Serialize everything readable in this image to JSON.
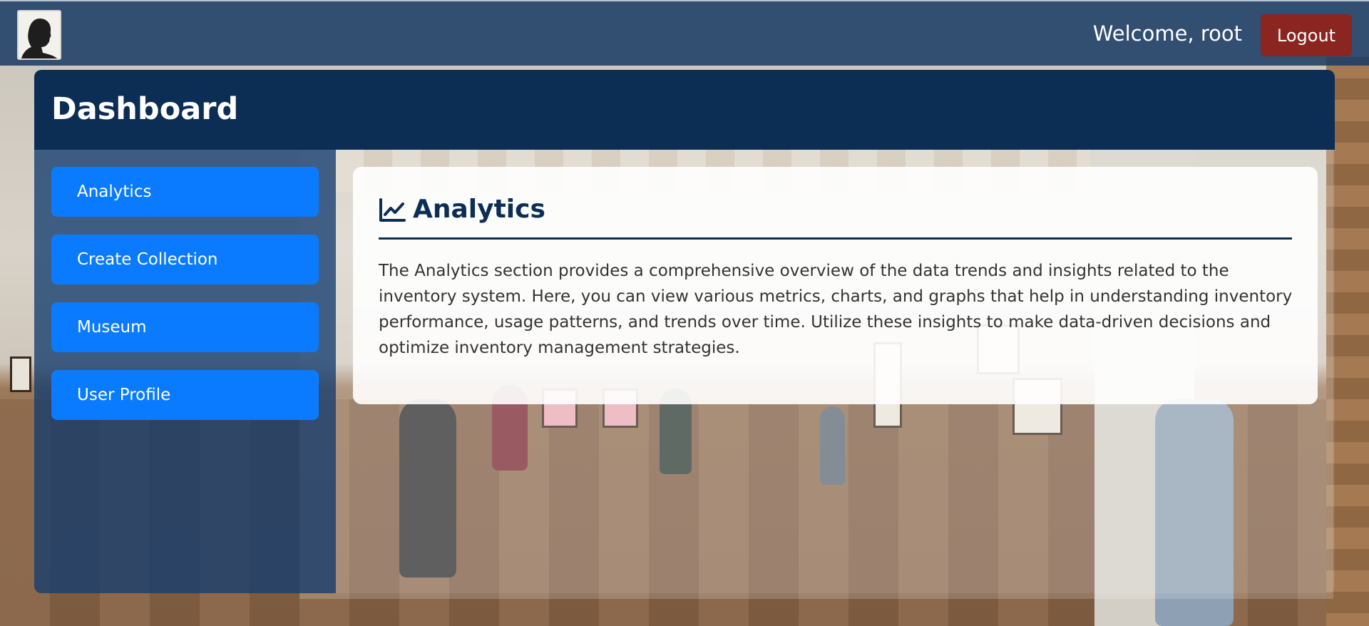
{
  "header": {
    "welcome_text": "Welcome, root",
    "logout_label": "Logout",
    "logo_icon": "silhouette-portrait-icon"
  },
  "dashboard": {
    "title": "Dashboard"
  },
  "sidebar": {
    "items": [
      {
        "label": "Analytics"
      },
      {
        "label": "Create Collection"
      },
      {
        "label": "Museum"
      },
      {
        "label": "User Profile"
      }
    ]
  },
  "main": {
    "section_icon": "line-chart-icon",
    "section_title": "Analytics",
    "section_text": "The Analytics section provides a comprehensive overview of the data trends and insights related to the inventory system. Here, you can view various metrics, charts, and graphs that help in understanding inventory performance, usage patterns, and trends over time. Utilize these insights to make data-driven decisions and optimize inventory management strategies."
  },
  "colors": {
    "navbar": "#183a64",
    "panel_header": "#0c2e55",
    "nav_button": "#0a7bff",
    "logout_button": "#8b2520",
    "card_title": "#0c2e55"
  }
}
